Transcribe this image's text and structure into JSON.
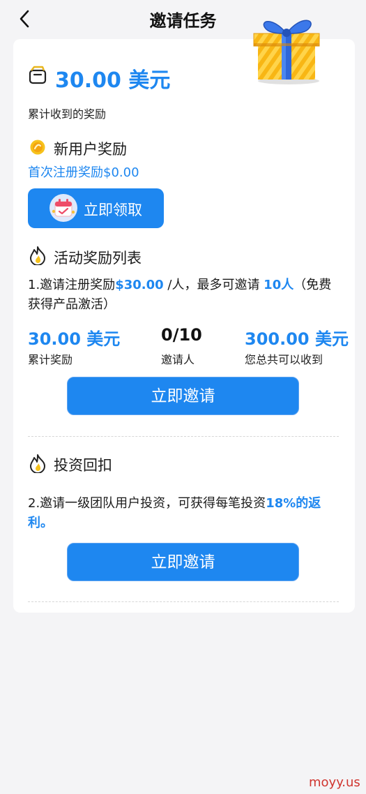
{
  "header": {
    "title": "邀请任务"
  },
  "summary": {
    "amount": "30.00 美元",
    "label": "累计收到的奖励"
  },
  "new_user": {
    "title": "新用户奖励",
    "desc": "首次注册奖励$0.00",
    "claim_label": "立即领取"
  },
  "activity": {
    "title": "活动奖励列表",
    "rule_prefix": "1.邀请注册奖励",
    "rule_amount": "$30.00",
    "rule_mid": " /人，最多可邀请 ",
    "rule_people": "10人",
    "rule_suffix": "（免费获得产品激活）",
    "stats": [
      {
        "value": "30.00 美元",
        "label": "累计奖励"
      },
      {
        "value": "0/10",
        "label": "邀请人"
      },
      {
        "value": "300.00 美元",
        "label": "您总共可以收到"
      }
    ],
    "invite_label": "立即邀请"
  },
  "investment": {
    "title": "投资回扣",
    "rule_prefix": "2.邀请一级团队用户投资，可获得每笔投资",
    "rule_highlight": "18%的返利。",
    "invite_label": "立即邀请"
  },
  "watermark": "moyy.us",
  "colors": {
    "accent": "#1e87f0",
    "watermark": "#d0352f"
  },
  "icons": [
    "back-icon",
    "gift-box-icon",
    "wallet-icon",
    "coin-icon",
    "calendar-mascot-icon",
    "flame-icon"
  ]
}
